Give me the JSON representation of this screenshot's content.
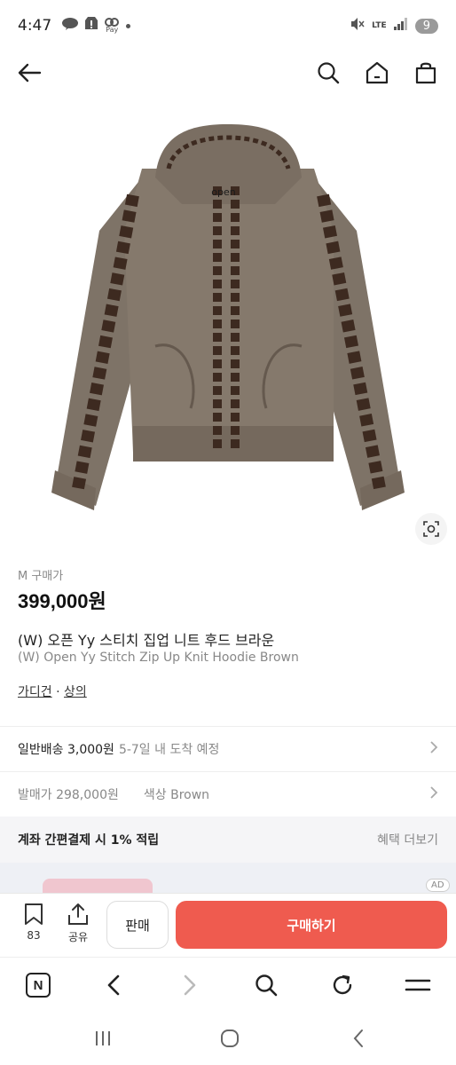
{
  "status_bar": {
    "time": "4:47",
    "left_icons": [
      "talk-icon",
      "alert-icon",
      "pay-icon",
      "dot-icon"
    ],
    "pay_label": "Pay",
    "network": "LTE",
    "notification_count": "9"
  },
  "header": {
    "icons": [
      "back-arrow-icon",
      "search-icon",
      "home-icon",
      "bag-icon"
    ]
  },
  "product": {
    "image_brand_text": "open",
    "price_label": "M 구매가",
    "price": "399,000원",
    "title_ko": "(W) 오픈 Yy 스티치 집업 니트 후드 브라운",
    "title_en": "(W) Open Yy Stitch Zip Up Knit Hoodie Brown",
    "categories": [
      "가디건",
      "상의"
    ],
    "category_separator": " · "
  },
  "shipping_row": {
    "label": "일반배송 3,000원",
    "detail": "5-7일 내 도착 예정"
  },
  "release_row": {
    "label": "발매가 298,000원",
    "color_label": "색상 Brown"
  },
  "benefit": {
    "text": "계좌 간편결제 시 1% 적립",
    "more": "혜택 더보기"
  },
  "ad": {
    "badge": "AD"
  },
  "action_bar": {
    "bookmark_count": "83",
    "share_label": "공유",
    "sell_label": "판매",
    "buy_label": "구매하기",
    "buy_color": "#ef5b4f"
  },
  "browser_toolbar": {
    "icons": [
      "naver-n-icon",
      "back-icon",
      "forward-icon",
      "search-icon",
      "reload-icon",
      "menu-icon"
    ],
    "naver_label": "N"
  },
  "android_nav": {
    "icons": [
      "recents-icon",
      "home-circle-icon",
      "back-chevron-icon"
    ]
  }
}
